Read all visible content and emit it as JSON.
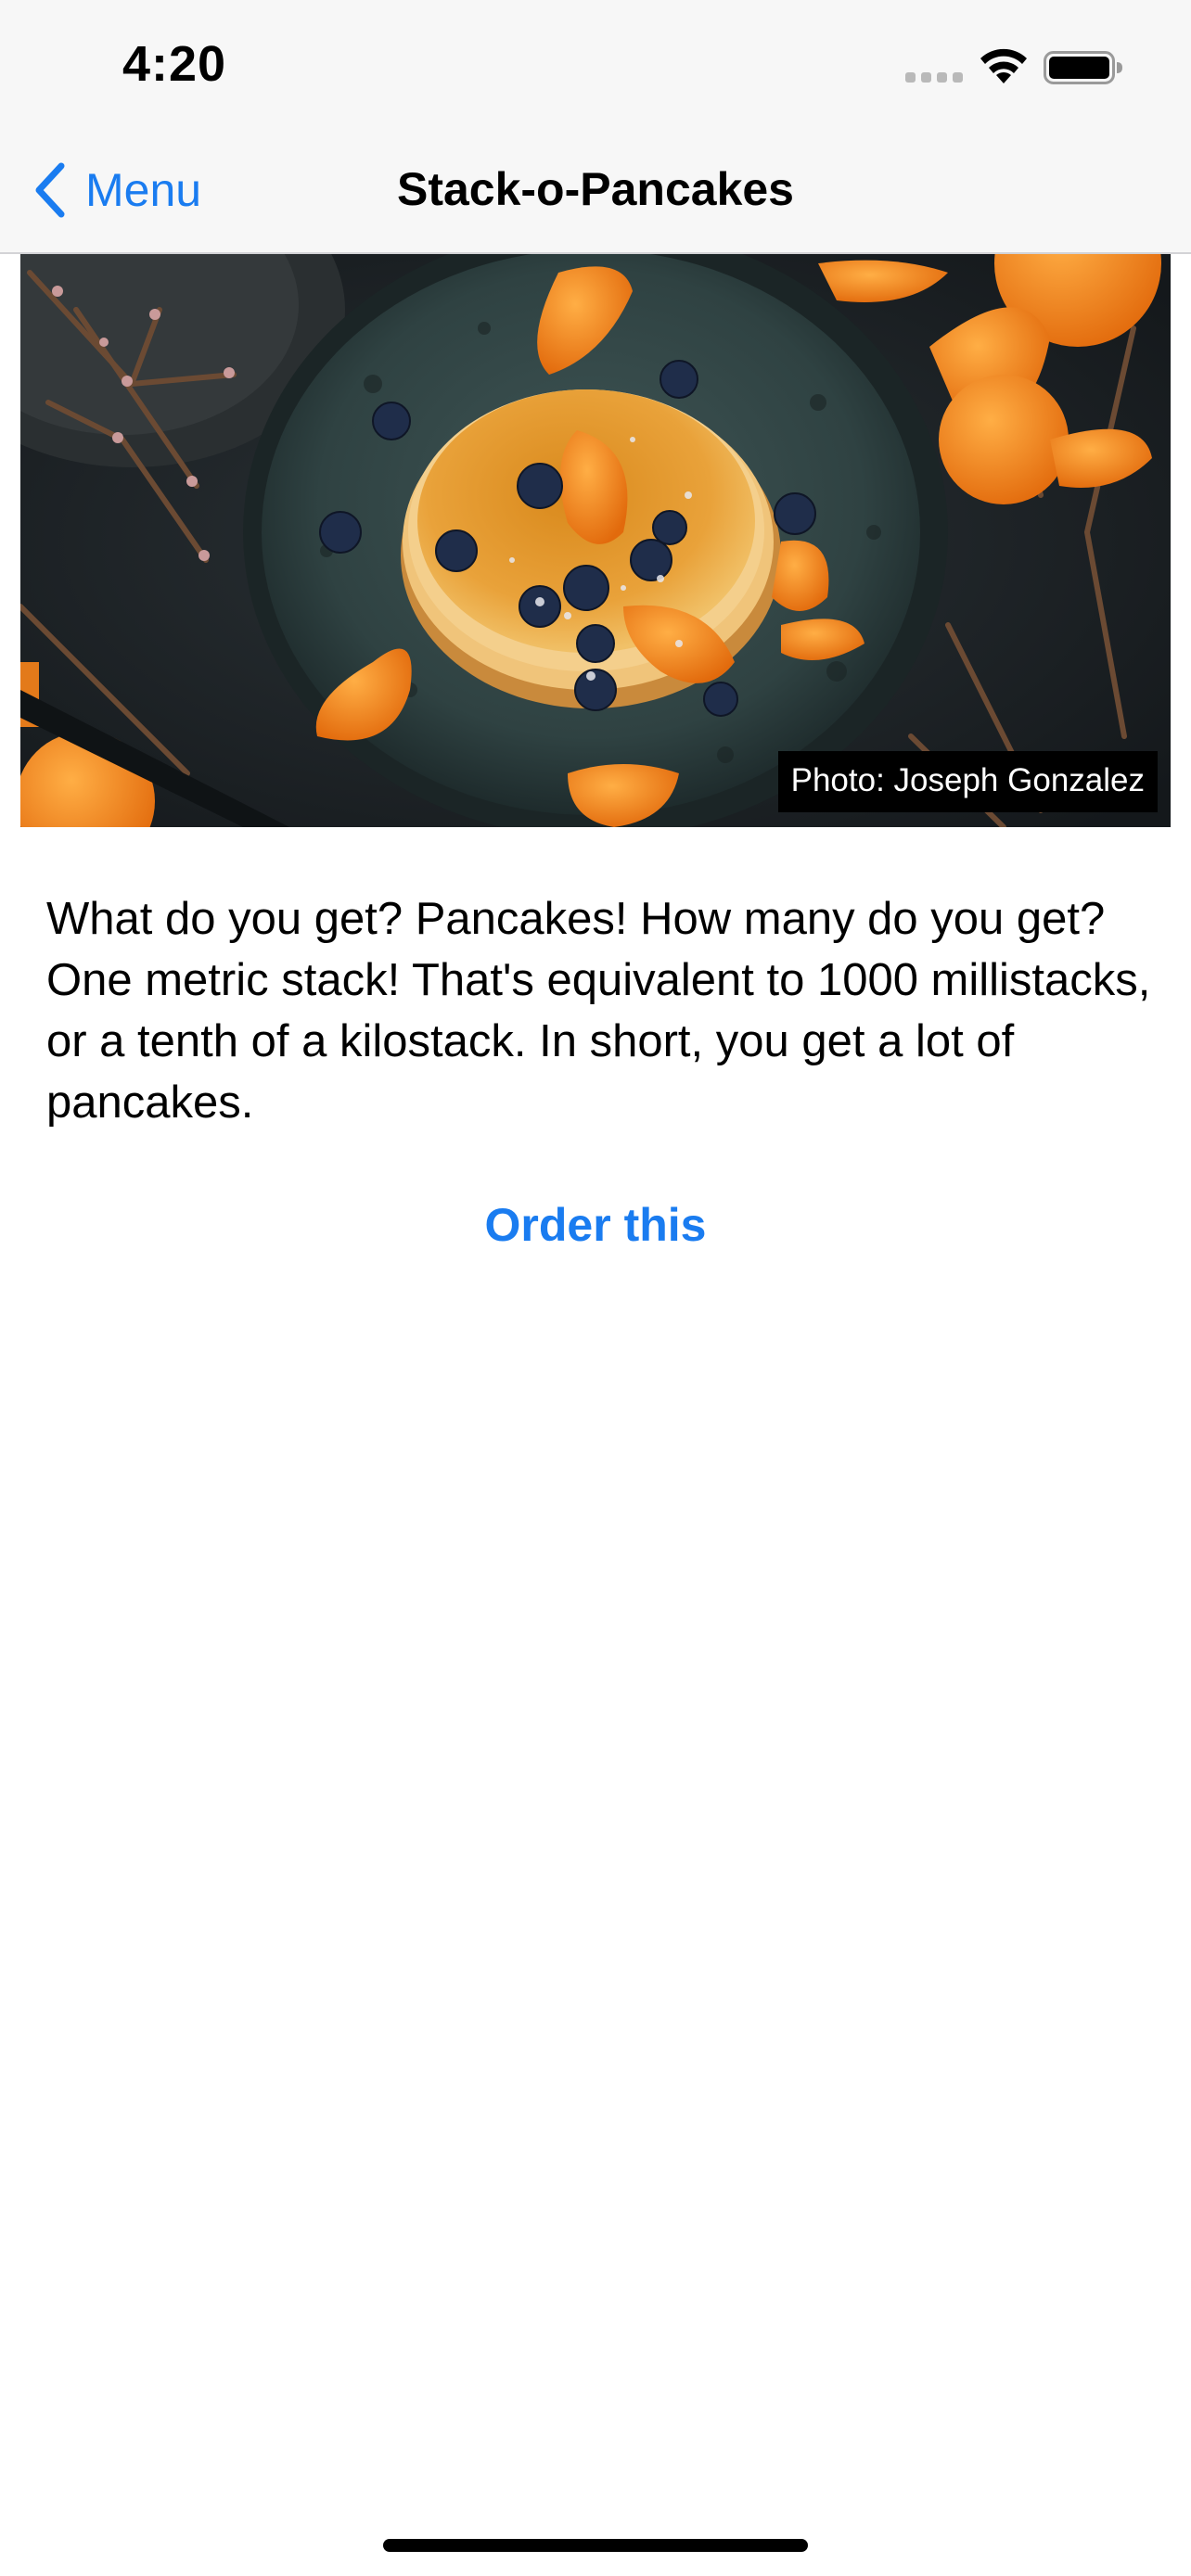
{
  "status_bar": {
    "time": "4:20",
    "signal_icon": "cellular-signal-icon",
    "wifi_icon": "wifi-icon",
    "battery_icon": "battery-icon"
  },
  "nav": {
    "back_label": "Menu",
    "back_icon": "chevron-left-icon",
    "title": "Stack-o-Pancakes",
    "accent_color": "#1a7cf0"
  },
  "hero": {
    "photo_credit": "Photo: Joseph Gonzalez"
  },
  "item": {
    "description": "What do you get? Pancakes! How many do you get? One metric stack! That's equivalent to 1000 millistacks, or a tenth of a kilostack. In short, you get a lot of pancakes.",
    "order_label": "Order this"
  }
}
